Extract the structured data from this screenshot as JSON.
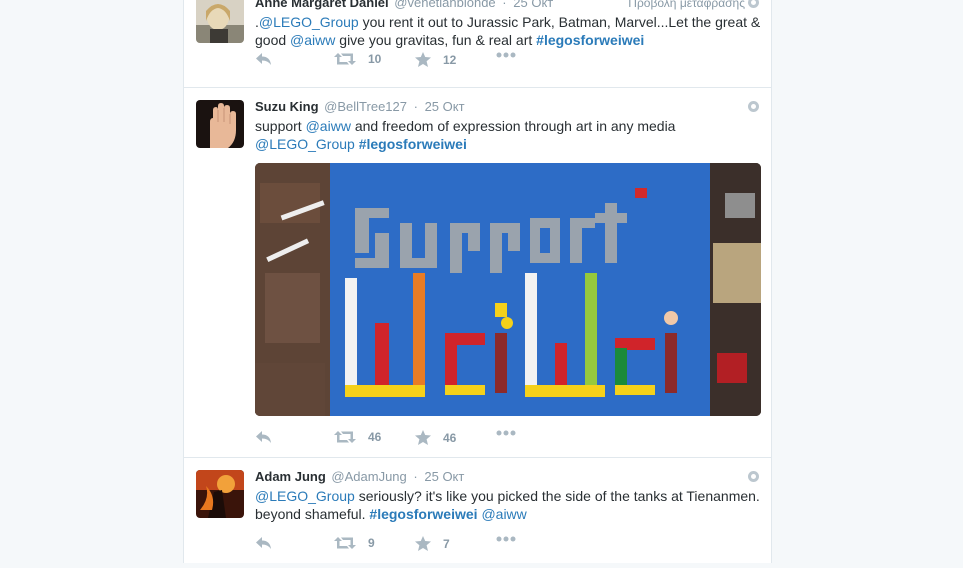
{
  "colors": {
    "link": "#2b7bb9",
    "text": "#292f33",
    "muted": "#8899a6",
    "border": "#e1e8ed",
    "background": "#f5f8fa"
  },
  "tweets": [
    {
      "fullname": "Anne Margaret Daniel",
      "username": "@venetianblonde",
      "time": "25 Окт",
      "promo": "Προβολή μετάφρασης",
      "text_segments": [
        {
          "t": ".",
          "k": "text"
        },
        {
          "t": "@LEGO_Group",
          "k": "mention"
        },
        {
          "t": " you rent it out to Jurassic Park, Batman, Marvel...Let the great & good ",
          "k": "text"
        },
        {
          "t": "@aiww",
          "k": "mention"
        },
        {
          "t": " give you gravitas, fun & real art ",
          "k": "text"
        },
        {
          "t": "#legosforweiwei",
          "k": "hashtag"
        }
      ],
      "retweets": "10",
      "favorites": "12"
    },
    {
      "fullname": "Suzu King",
      "username": "@BellTree127",
      "time": "25 Окт",
      "text_segments": [
        {
          "t": "support ",
          "k": "text"
        },
        {
          "t": "@aiww",
          "k": "mention"
        },
        {
          "t": " and freedom of expression through art in any media ",
          "k": "text"
        },
        {
          "t": "@LEGO_Group",
          "k": "mention"
        },
        {
          "t": " ",
          "k": "text"
        },
        {
          "t": "#legosforweiwei",
          "k": "hashtag"
        }
      ],
      "media_text": [
        "Support",
        "Wei Wei"
      ],
      "retweets": "46",
      "favorites": "46"
    },
    {
      "fullname": "Adam Jung",
      "username": "@AdamJung",
      "time": "25 Окт",
      "text_segments": [
        {
          "t": "@LEGO_Group",
          "k": "mention"
        },
        {
          "t": " seriously? it's like you picked the side of the tanks at Tienanmen. beyond shameful. ",
          "k": "text"
        },
        {
          "t": "#legosforweiwei",
          "k": "hashtag"
        },
        {
          "t": " ",
          "k": "text"
        },
        {
          "t": "@aiww",
          "k": "mention"
        }
      ],
      "retweets": "9",
      "favorites": "7"
    }
  ],
  "icons": {
    "reply": "reply-icon",
    "retweet": "retweet-icon",
    "favorite": "star-icon",
    "more": "more-icon",
    "globe": "globe-icon"
  }
}
